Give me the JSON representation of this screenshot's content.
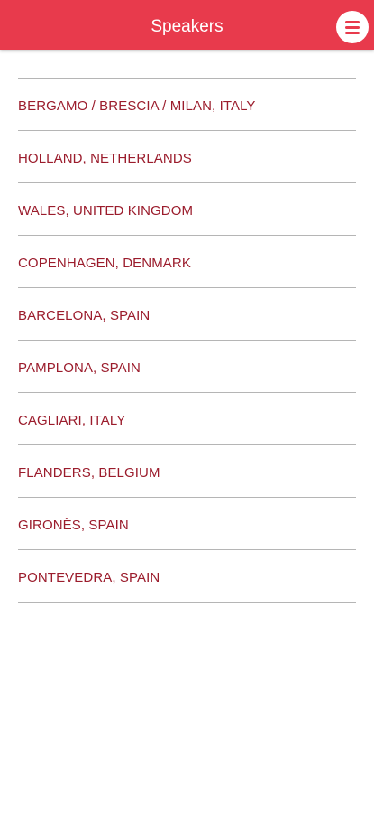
{
  "header": {
    "title": "Speakers",
    "menu_icon": "hamburger-menu-icon"
  },
  "colors": {
    "accent": "#e83a4c",
    "item_text": "#9b1c2c",
    "divider": "#b5b5b5"
  },
  "speakers": {
    "items": [
      {
        "label": "BERGAMO / BRESCIA / MILAN, ITALY"
      },
      {
        "label": "HOLLAND, NETHERLANDS"
      },
      {
        "label": "WALES, UNITED KINGDOM"
      },
      {
        "label": "COPENHAGEN, DENMARK"
      },
      {
        "label": "BARCELONA, SPAIN"
      },
      {
        "label": "PAMPLONA, SPAIN"
      },
      {
        "label": "CAGLIARI, ITALY"
      },
      {
        "label": "FLANDERS, BELGIUM"
      },
      {
        "label": "GIRONÈS, SPAIN"
      },
      {
        "label": "PONTEVEDRA, SPAIN"
      }
    ]
  }
}
